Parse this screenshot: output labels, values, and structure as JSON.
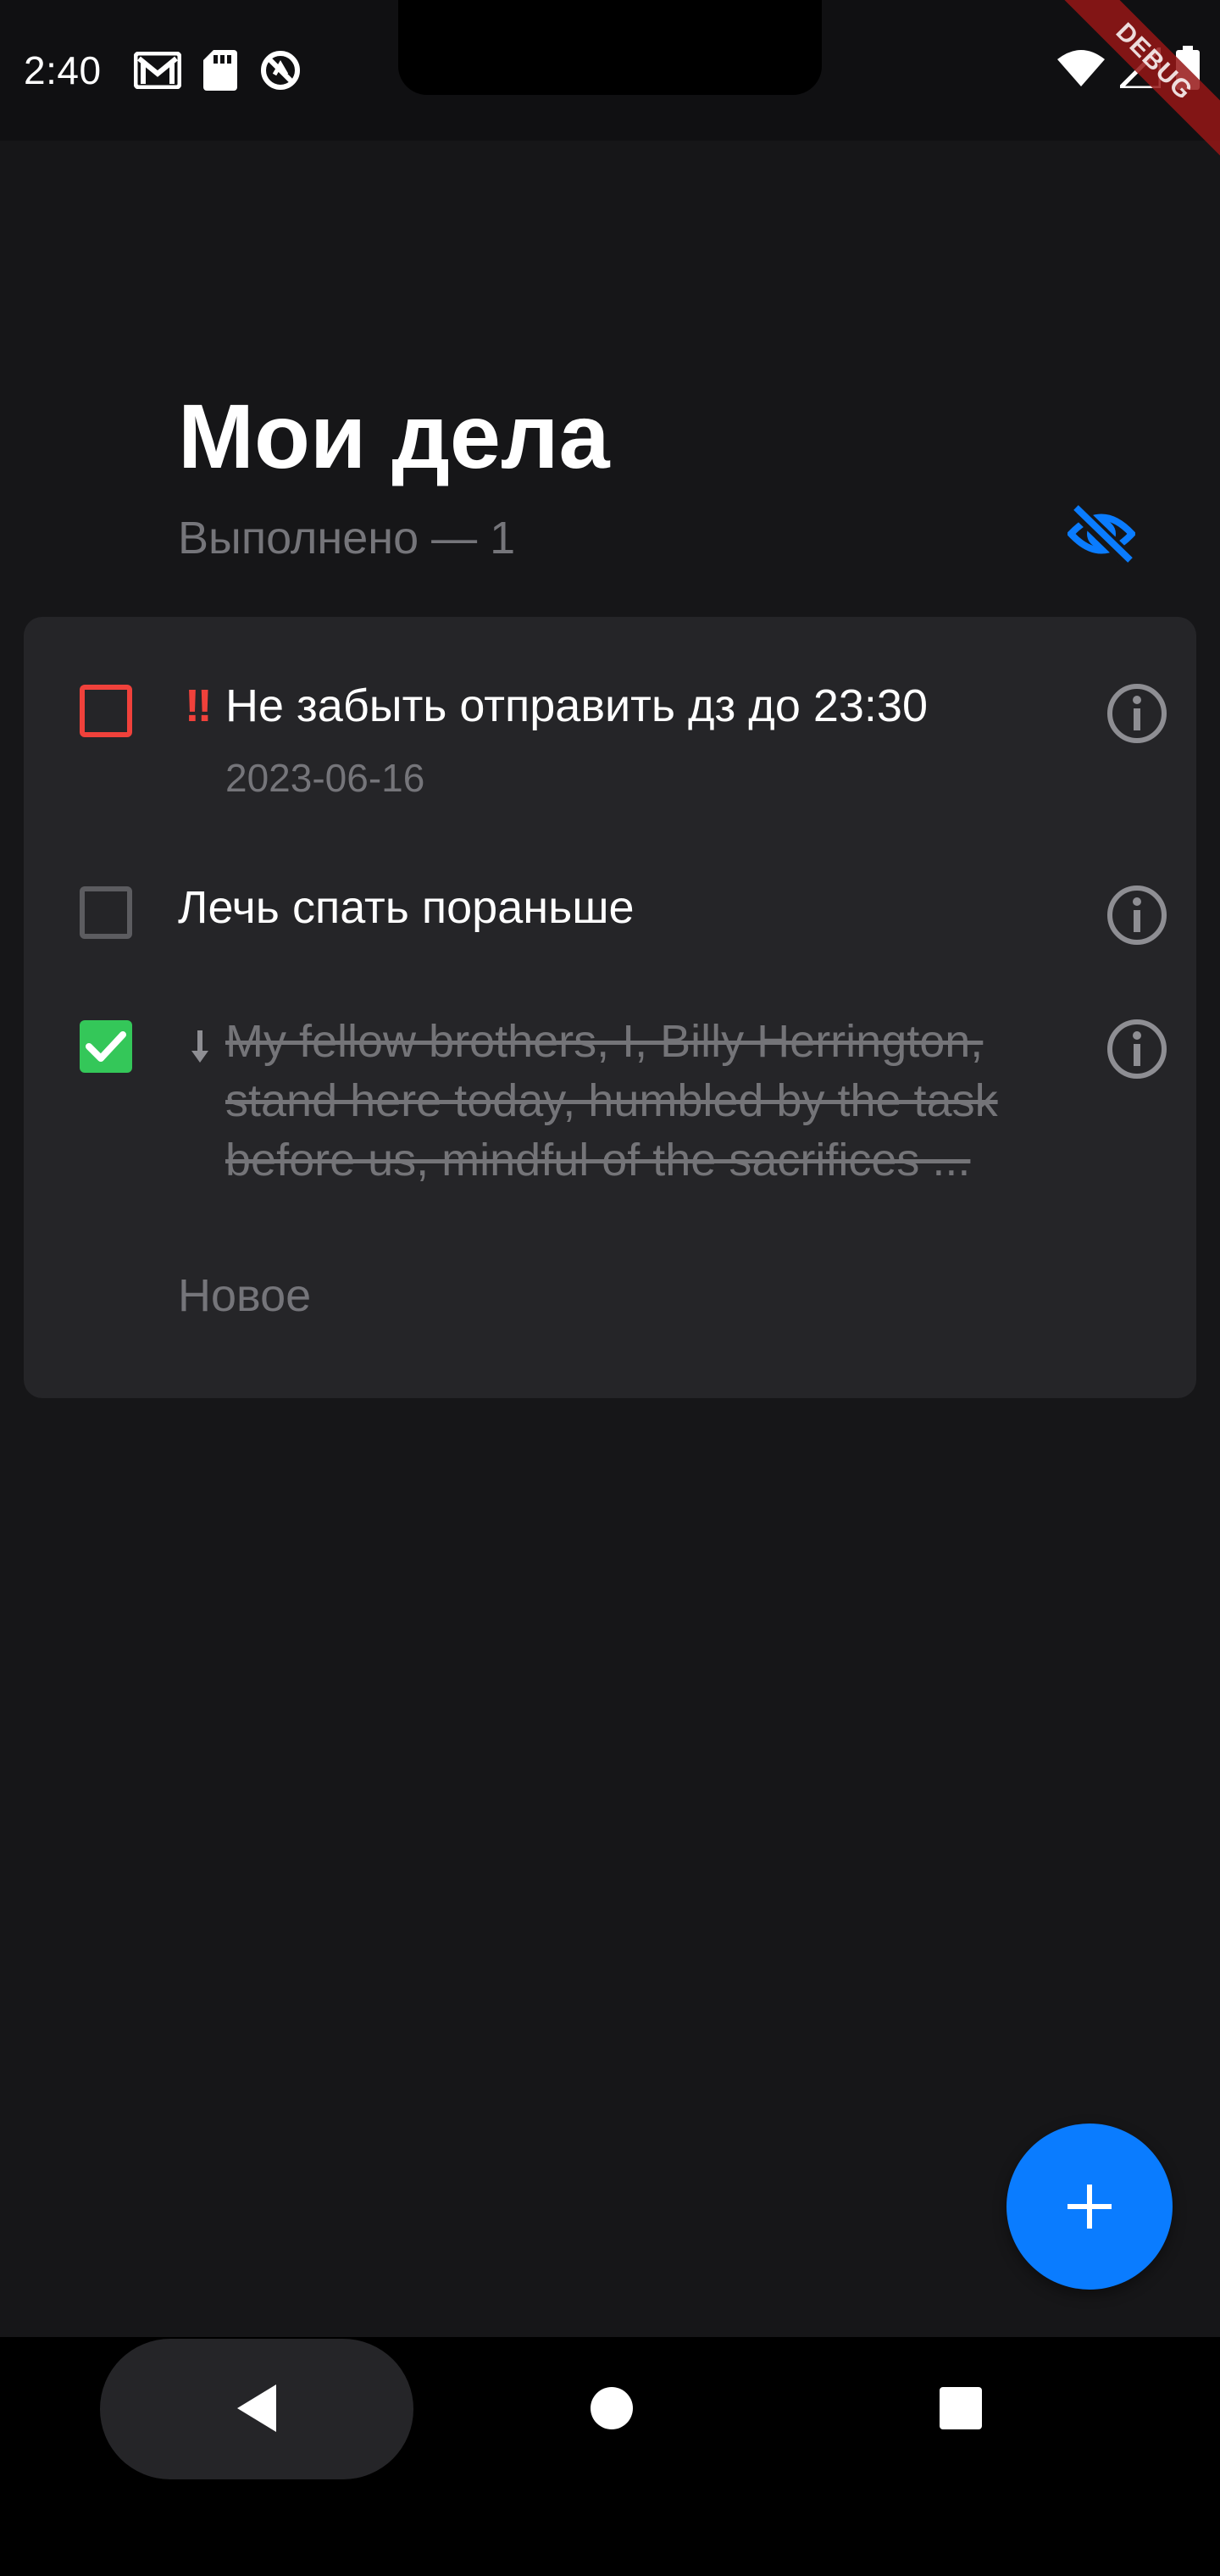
{
  "status_bar": {
    "time": "2:40",
    "left_icons": [
      "gmail-icon",
      "sd-card-icon",
      "no-disturb-icon"
    ],
    "right_icons": [
      "wifi-icon",
      "signal-icon",
      "battery-icon"
    ],
    "debug_label": "DEBUG"
  },
  "header": {
    "title": "Мои дела",
    "done_counter": "Выполнено — 1",
    "visibility_icon": "eye-off-icon"
  },
  "tasks": [
    {
      "text": "Не забыть отправить дз до 23:30",
      "priority_mark": "‼",
      "date": "2023-06-16",
      "checked": false,
      "priority": "high"
    },
    {
      "text": "Лечь спать пораньше",
      "checked": false,
      "priority": "none"
    },
    {
      "lines": [
        "My fellow brothers, I, Billy Herrington,",
        "stand here today, humbled by the task",
        "before us, mindful of the sacrifices ..."
      ],
      "checked": true,
      "priority": "low"
    }
  ],
  "new_task_placeholder": "Новое",
  "colors": {
    "background": "#161618",
    "card": "#252528",
    "accent_blue": "#0a7cff",
    "priority_red": "#f0413b",
    "done_green": "#34c759",
    "secondary_text": "#75757a"
  }
}
